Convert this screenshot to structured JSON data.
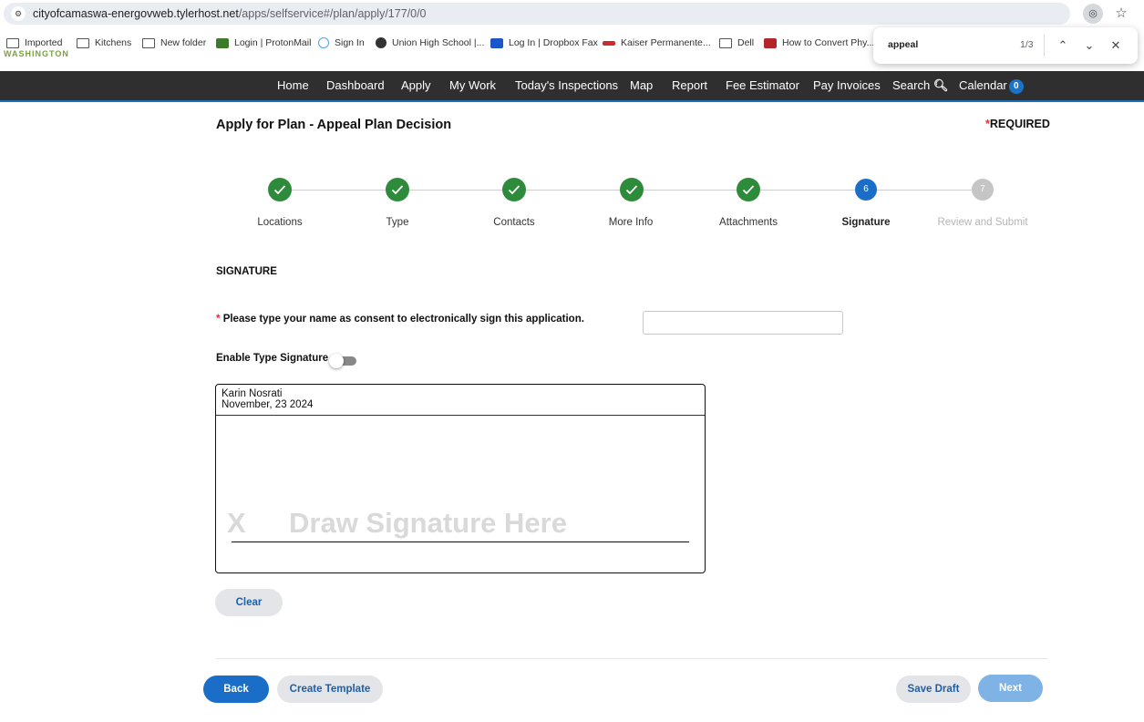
{
  "browser": {
    "url_host": "cityofcamaswa-energovweb.tylerhost.net",
    "url_path": "/apps/selfservice#/plan/apply/177/0/0",
    "bookmarks": [
      {
        "label": "Imported",
        "icon": "folder-icon"
      },
      {
        "label": "Kitchens",
        "icon": "folder-icon"
      },
      {
        "label": "New folder",
        "icon": "folder-icon"
      },
      {
        "label": "Login | ProtonMail",
        "icon": "protonmail-icon"
      },
      {
        "label": "Sign In",
        "icon": "sign-in-icon"
      },
      {
        "label": "Union High School |...",
        "icon": "school-icon"
      },
      {
        "label": "Log In | Dropbox Fax",
        "icon": "dropbox-icon"
      },
      {
        "label": "Kaiser Permanente...",
        "icon": "kaiser-icon"
      },
      {
        "label": "Dell",
        "icon": "folder-icon"
      },
      {
        "label": "How to Convert Phy...",
        "icon": "article-icon"
      }
    ],
    "find": {
      "query": "appeal",
      "count": "1/3"
    },
    "partial_logo_text": "WASHINGTON"
  },
  "nav": {
    "items": [
      "Home",
      "Dashboard",
      "Apply",
      "My Work",
      "Today's Inspections",
      "Map",
      "Report",
      "Fee Estimator",
      "Pay Invoices",
      "Search",
      "Calendar"
    ],
    "calendar_count": "0"
  },
  "page": {
    "title": "Apply for Plan - Appeal Plan Decision",
    "required_marker": "*",
    "required_label": "REQUIRED"
  },
  "steps": [
    {
      "label": "Locations",
      "state": "done",
      "number": "1"
    },
    {
      "label": "Type",
      "state": "done",
      "number": "2"
    },
    {
      "label": "Contacts",
      "state": "done",
      "number": "3"
    },
    {
      "label": "More Info",
      "state": "done",
      "number": "4"
    },
    {
      "label": "Attachments",
      "state": "done",
      "number": "5"
    },
    {
      "label": "Signature",
      "state": "active",
      "number": "6"
    },
    {
      "label": "Review and Submit",
      "state": "todo",
      "number": "7"
    }
  ],
  "signature": {
    "section_title": "SIGNATURE",
    "consent_marker": "*",
    "consent_label": "Please type your name as consent to electronically sign this application.",
    "consent_value": "",
    "enable_type_label": "Enable Type Signature",
    "enable_type_on": false,
    "signer_name": "Karin Nosrati",
    "signer_date": "November, 23 2024",
    "x_mark": "X",
    "draw_placeholder": "Draw Signature Here",
    "clear_label": "Clear"
  },
  "footer": {
    "back_label": "Back",
    "template_label": "Create Template",
    "save_draft_label": "Save Draft",
    "next_label": "Next"
  },
  "colors": {
    "nav_bg": "#2f2f2f",
    "accent": "#1a6ec8",
    "done": "#2e8b3c",
    "required": "#d9332b"
  }
}
